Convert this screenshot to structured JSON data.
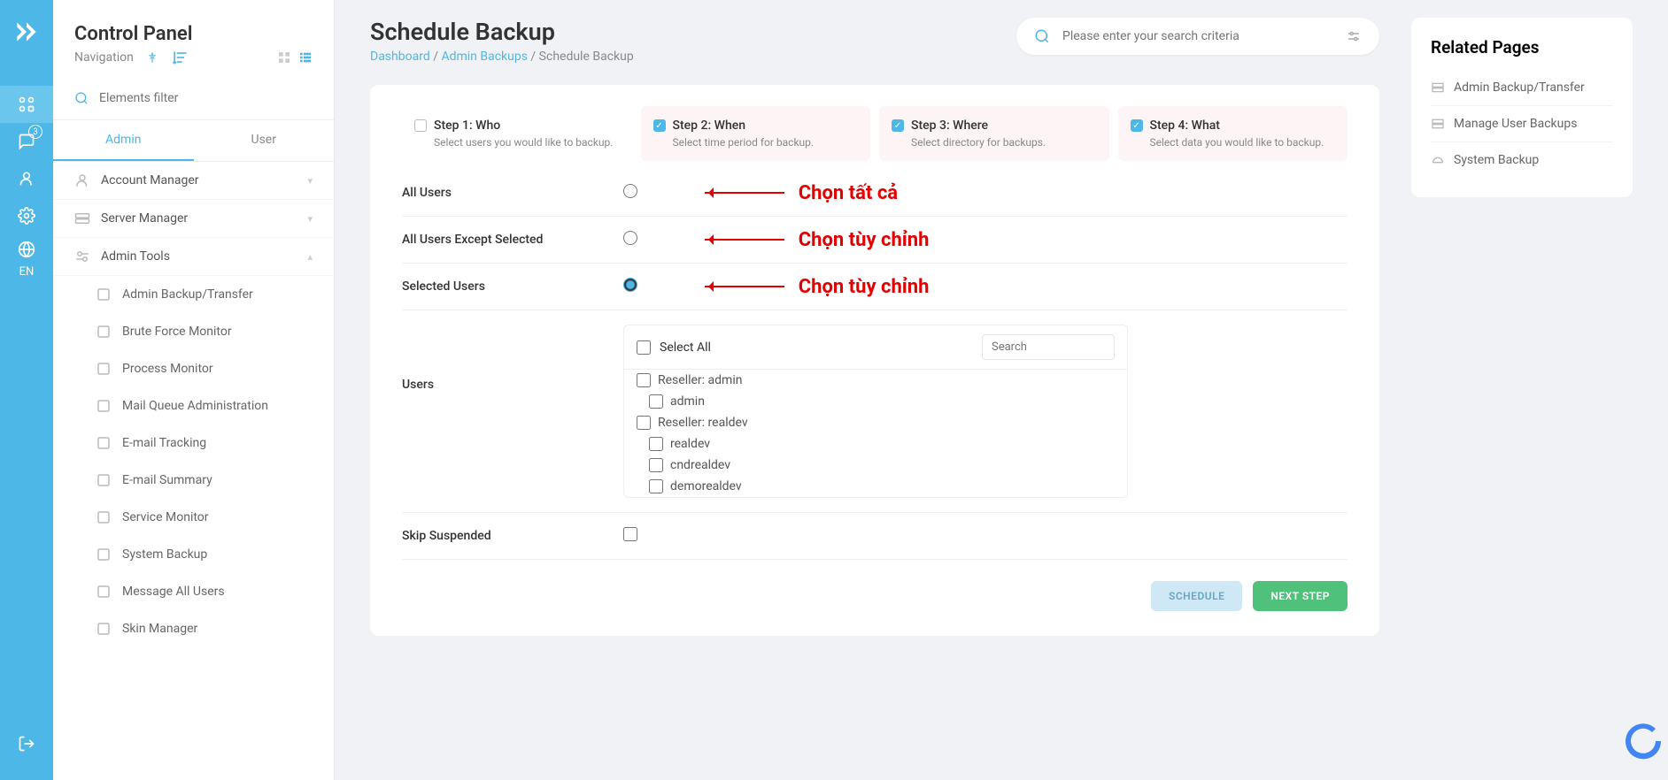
{
  "rail": {
    "lang": "EN",
    "badge": "3"
  },
  "sidebar": {
    "title": "Control Panel",
    "navigation": "Navigation",
    "filter_placeholder": "Elements filter",
    "tabs": [
      "Admin",
      "User"
    ],
    "accordions": [
      {
        "label": "Account Manager"
      },
      {
        "label": "Server Manager"
      },
      {
        "label": "Admin Tools"
      }
    ],
    "tools": [
      "Admin Backup/Transfer",
      "Brute Force Monitor",
      "Process Monitor",
      "Mail Queue Administration",
      "E-mail Tracking",
      "E-mail Summary",
      "Service Monitor",
      "System Backup",
      "Message All Users",
      "Skin Manager"
    ]
  },
  "page": {
    "title": "Schedule Backup",
    "crumbs": [
      "Dashboard",
      "Admin Backups",
      "Schedule Backup"
    ],
    "search_placeholder": "Please enter your search criteria"
  },
  "steps": [
    {
      "title": "Step 1: Who",
      "desc": "Select users you would like to backup.",
      "checked": false
    },
    {
      "title": "Step 2: When",
      "desc": "Select time period for backup.",
      "checked": true
    },
    {
      "title": "Step 3: Where",
      "desc": "Select directory for backups.",
      "checked": true
    },
    {
      "title": "Step 4: What",
      "desc": "Select data you would like to backup.",
      "checked": true
    }
  ],
  "who": {
    "options": [
      {
        "label": "All Users",
        "annotation": "Chọn tất cả"
      },
      {
        "label": "All Users Except Selected",
        "annotation": "Chọn tùy chỉnh"
      },
      {
        "label": "Selected Users",
        "annotation": "Chọn tùy chỉnh"
      }
    ],
    "users_label": "Users",
    "select_all": "Select All",
    "search_placeholder": "Search",
    "list": [
      {
        "label": "Reseller: admin",
        "child": false
      },
      {
        "label": "admin",
        "child": true
      },
      {
        "label": "Reseller: realdev",
        "child": false
      },
      {
        "label": "realdev",
        "child": true
      },
      {
        "label": "cndrealdev",
        "child": true
      },
      {
        "label": "demorealdev",
        "child": true
      }
    ],
    "skip_suspended": "Skip Suspended"
  },
  "actions": {
    "schedule": "SCHEDULE",
    "next": "NEXT STEP"
  },
  "related": {
    "title": "Related Pages",
    "links": [
      "Admin Backup/Transfer",
      "Manage User Backups",
      "System Backup"
    ]
  }
}
